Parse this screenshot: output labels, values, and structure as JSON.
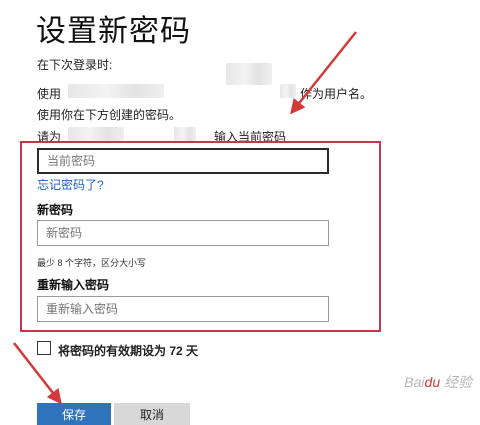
{
  "title": "设置新密码",
  "intro": {
    "line1": "在下次登录时:",
    "line2_prefix": "使用",
    "line2_suffix": "作为用户名。",
    "line3": "使用你在下方创建的密码。",
    "line4_prefix": "请为",
    "line4_suffix": "输入当前密码"
  },
  "form": {
    "current_password_placeholder": "当前密码",
    "forgot_link": "忘记密码了?",
    "new_password_label": "新密码",
    "new_password_placeholder": "新密码",
    "hint": "最少 8 个字符，区分大小写",
    "confirm_label": "重新输入密码",
    "confirm_placeholder": "重新输入密码"
  },
  "expire_checkbox": {
    "label": "将密码的有效期设为 72 天",
    "checked": false
  },
  "buttons": {
    "save": "保存",
    "cancel": "取消"
  },
  "watermark": "Baidu 经验",
  "colors": {
    "highlight_box": "#c0394b",
    "annotation_arrow": "#d23a3a",
    "primary_button": "#2f73bd",
    "link": "#1d63c6"
  }
}
